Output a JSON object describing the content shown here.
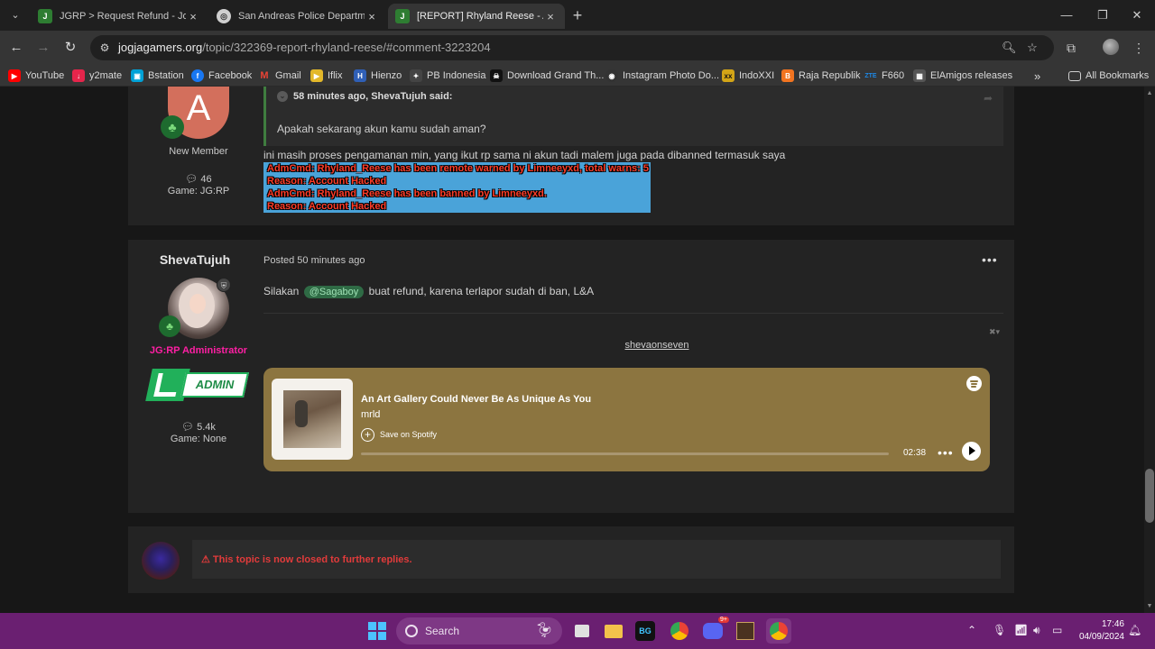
{
  "browser": {
    "tabs": [
      {
        "title": "JGRP > Request Refund - Jogjag",
        "active": false
      },
      {
        "title": "San Andreas Police Department",
        "active": false
      },
      {
        "title": "[REPORT] Rhyland Reese - Arch",
        "active": true
      }
    ],
    "url_host": "jogjagamers.org",
    "url_path": "/topic/322369-report-rhyland-reese/#comment-3223204",
    "bookmarks": [
      {
        "label": "YouTube",
        "color": "#ff0000"
      },
      {
        "label": "y2mate",
        "color": "#e5254b"
      },
      {
        "label": "Bstation",
        "color": "#00a1d6"
      },
      {
        "label": "Facebook",
        "color": "#1877f2"
      },
      {
        "label": "Gmail",
        "color": "#ea4335"
      },
      {
        "label": "Iflix",
        "color": "#e3b82a"
      },
      {
        "label": "Hienzo",
        "color": "#2f5fb6"
      },
      {
        "label": "PB Indonesia",
        "color": "#444444"
      },
      {
        "label": "Download Grand Th...",
        "color": "#111111"
      },
      {
        "label": "Instagram Photo Do...",
        "color": "#333333"
      },
      {
        "label": "IndoXXI",
        "color": "#d3a517"
      },
      {
        "label": "Raja Republik",
        "color": "#f27420"
      },
      {
        "label": "F660",
        "color": "#1e88e5"
      },
      {
        "label": "ElAmigos releases",
        "color": "#555555"
      }
    ],
    "all_bookmarks": "All Bookmarks"
  },
  "post1": {
    "avatar_letter": "A",
    "rank": "New Member",
    "posts": "46",
    "game": "Game: JG:RP",
    "quote_cite": "58 minutes ago, ShevaTujuh said:",
    "quote_text": "Apakah sekarang akun kamu sudah aman?",
    "body": "ini masih proses pengamanan min, yang ikut rp sama ni akun tadi malem juga pada dibanned termasuk saya",
    "chatlog": [
      "AdmCmd: Rhyland_Reese has been remote warned by Limneeyxd, total warns: 5",
      "Reason: Account Hacked",
      "AdmCmd: Rhyland_Reese has been banned by Limneeyxd.",
      "Reason: Account Hacked"
    ]
  },
  "post2": {
    "author": "ShevaTujuh",
    "role": "JG:RP Administrator",
    "badge_text": "ADMIN",
    "posts": "5.4k",
    "game": "Game: None",
    "posted": "Posted 50 minutes ago",
    "body_before": "Silakan",
    "mention": "@Sagaboy",
    "body_after": "buat refund, karena terlapor sudah di ban, L&A",
    "embed_user": "shevaonseven",
    "spotify": {
      "title": "An Art Gallery Could Never Be As Unique As You",
      "artist": "mrld",
      "save": "Save on Spotify",
      "time": "02:38"
    }
  },
  "closed_notice": "This topic is now closed to further replies.",
  "taskbar": {
    "search": "Search",
    "time": "17:46",
    "date": "04/09/2024"
  }
}
